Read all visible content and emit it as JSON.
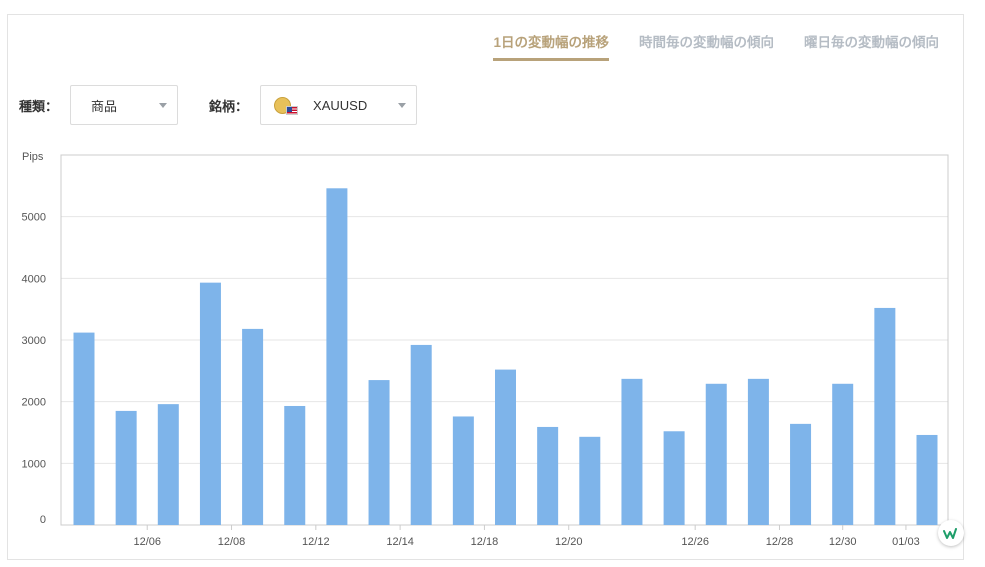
{
  "tabs": [
    {
      "label": "1日の変動幅の推移",
      "active": true
    },
    {
      "label": "時間毎の変動幅の傾向",
      "active": false
    },
    {
      "label": "曜日毎の変動幅の傾向",
      "active": false
    }
  ],
  "filters": {
    "kind_label": "種類：",
    "kind_value": "商品",
    "symbol_label": "銘柄：",
    "symbol_value": "XAUUSD"
  },
  "colors": {
    "bar": "#7eb4ea",
    "accent": "#b8a27a",
    "inactive_tab": "#b5bcc4"
  },
  "chart_data": {
    "type": "bar",
    "ylabel": "Pips",
    "ylim": [
      0,
      6000
    ],
    "yticks": [
      0,
      1000,
      2000,
      3000,
      4000,
      5000
    ],
    "grid": true,
    "values": [
      3120,
      1850,
      1960,
      3930,
      3180,
      1930,
      5460,
      2350,
      2920,
      1760,
      2520,
      1590,
      1430,
      2370,
      1520,
      2290,
      2370,
      1640,
      2290,
      3520,
      1460
    ],
    "xtick_labels": [
      {
        "label": "12/06",
        "at": 1
      },
      {
        "label": "12/08",
        "at": 3
      },
      {
        "label": "12/12",
        "at": 5
      },
      {
        "label": "12/14",
        "at": 7
      },
      {
        "label": "12/18",
        "at": 9
      },
      {
        "label": "12/20",
        "at": 11
      },
      {
        "label": "12/26",
        "at": 14
      },
      {
        "label": "12/28",
        "at": 16
      },
      {
        "label": "12/30",
        "at": 17.5
      },
      {
        "label": "01/03",
        "at": 19
      }
    ]
  }
}
